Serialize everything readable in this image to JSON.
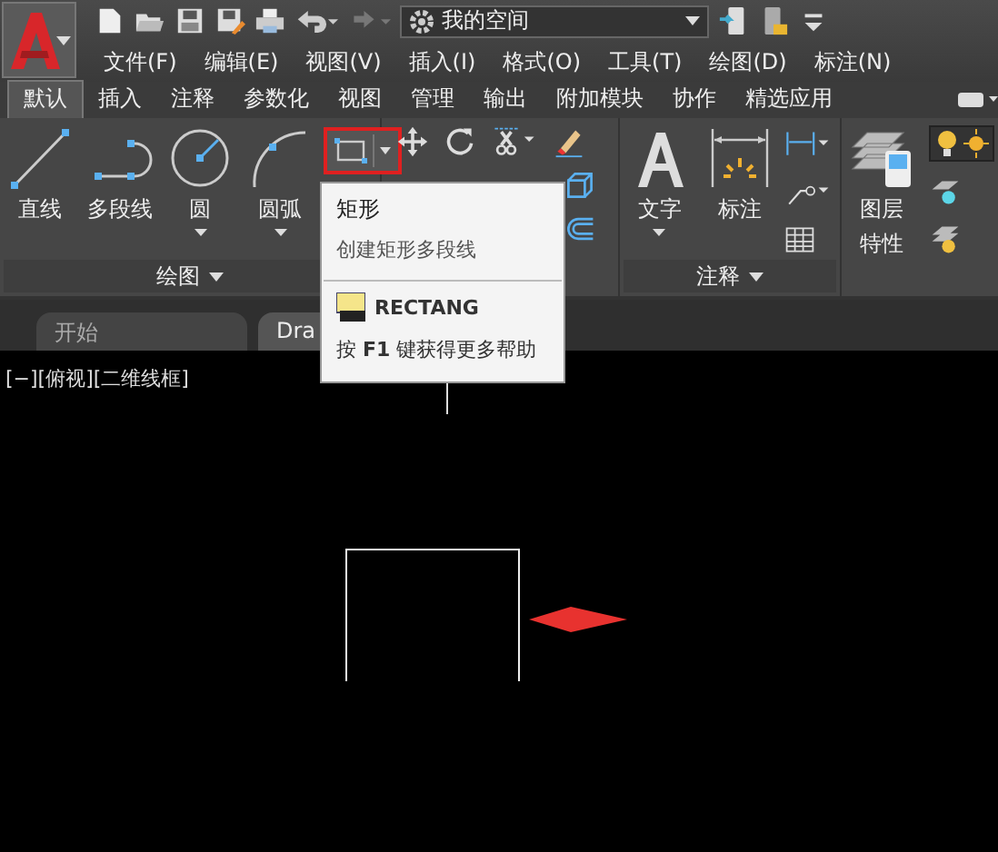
{
  "workspace": {
    "value": "我的空间"
  },
  "menu": [
    "文件(F)",
    "编辑(E)",
    "视图(V)",
    "插入(I)",
    "格式(O)",
    "工具(T)",
    "绘图(D)",
    "标注(N)"
  ],
  "ribbon_tabs": [
    {
      "label": "默认",
      "selected": true
    },
    {
      "label": "插入",
      "selected": false
    },
    {
      "label": "注释",
      "selected": false
    },
    {
      "label": "参数化",
      "selected": false
    },
    {
      "label": "视图",
      "selected": false
    },
    {
      "label": "管理",
      "selected": false
    },
    {
      "label": "输出",
      "selected": false
    },
    {
      "label": "附加模块",
      "selected": false
    },
    {
      "label": "协作",
      "selected": false
    },
    {
      "label": "精选应用",
      "selected": false
    }
  ],
  "draw_panel": {
    "title": "绘图",
    "tools": [
      {
        "kind": "line",
        "label": "直线",
        "has_menu": false
      },
      {
        "kind": "polyline",
        "label": "多段线",
        "has_menu": false
      },
      {
        "kind": "circle",
        "label": "圆",
        "has_menu": true
      },
      {
        "kind": "arc",
        "label": "圆弧",
        "has_menu": true
      }
    ],
    "rectangle": {
      "highlighted": true
    }
  },
  "annotation_panel": {
    "title": "注释",
    "tools": [
      {
        "kind": "text",
        "label": "文字",
        "has_menu": true
      },
      {
        "kind": "dimension",
        "label": "标注",
        "has_menu": false
      }
    ]
  },
  "layers_panel": {
    "label_lines": [
      "图层",
      "特性"
    ],
    "light_toggle": {
      "selected": true
    }
  },
  "tooltip": {
    "title": "矩形",
    "description": "创建矩形多段线",
    "command": "RECTANG",
    "help": "按 **F1** 键获得更多帮助"
  },
  "doc_tabs": [
    {
      "label": "开始",
      "selected": false
    },
    {
      "label": "Dra",
      "selected": true
    }
  ],
  "viewport_label": "[−][俯视][二维线框]"
}
